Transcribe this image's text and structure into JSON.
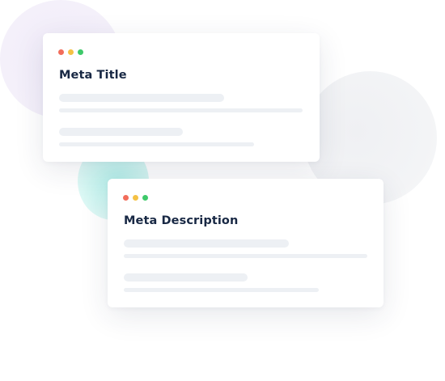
{
  "colors": {
    "dot_red": "#f26d5b",
    "dot_yellow": "#f5c144",
    "dot_green": "#3ec96a",
    "skeleton": "#edf0f4",
    "heading": "#182844"
  },
  "cards": [
    {
      "heading": "Meta Title",
      "window_dots": [
        "red-dot-icon",
        "yellow-dot-icon",
        "green-dot-icon"
      ]
    },
    {
      "heading": "Meta Description",
      "window_dots": [
        "red-dot-icon",
        "yellow-dot-icon",
        "green-dot-icon"
      ]
    }
  ]
}
